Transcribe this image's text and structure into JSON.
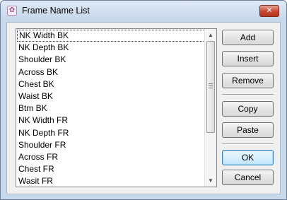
{
  "window": {
    "title": "Frame Name List",
    "close_glyph": "✕"
  },
  "list": {
    "selected_index": 0,
    "items": [
      "NK Width BK",
      "NK Depth BK",
      "Shoulder BK",
      "Across BK",
      "Chest BK",
      "Waist BK",
      "Btm BK",
      "NK Width FR",
      "NK Depth FR",
      "Shoulder FR",
      "Across FR",
      "Chest FR",
      "Wasit FR"
    ]
  },
  "buttons": {
    "add": "Add",
    "insert": "Insert",
    "remove": "Remove",
    "copy": "Copy",
    "paste": "Paste",
    "ok": "OK",
    "cancel": "Cancel"
  },
  "icons": {
    "app": "frame-list-app-icon",
    "close": "close-icon",
    "scroll_up": "scroll-up-arrow-icon",
    "scroll_down": "scroll-down-arrow-icon"
  }
}
